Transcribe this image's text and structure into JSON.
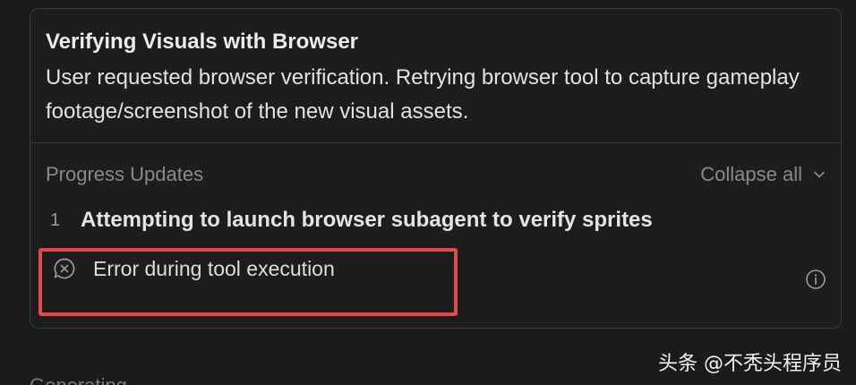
{
  "task": {
    "title": "Verifying Visuals with Browser",
    "description": "User requested browser verification. Retrying browser tool to capture gameplay footage/screenshot of the new visual assets."
  },
  "progress": {
    "label": "Progress Updates",
    "collapse_label": "Collapse all",
    "steps": [
      {
        "number": "1",
        "text": "Attempting to launch browser subagent to verify sprites"
      }
    ],
    "error": {
      "icon": "error-chat-icon",
      "text": "Error during tool execution"
    }
  },
  "footer": {
    "generating_label": "Generating",
    "watermark": "头条 @不秃头程序员"
  },
  "colors": {
    "highlight": "#e5484d",
    "background": "#1b1b1b",
    "card_border": "#3a3a3a",
    "muted_text": "#8a8a8a"
  }
}
